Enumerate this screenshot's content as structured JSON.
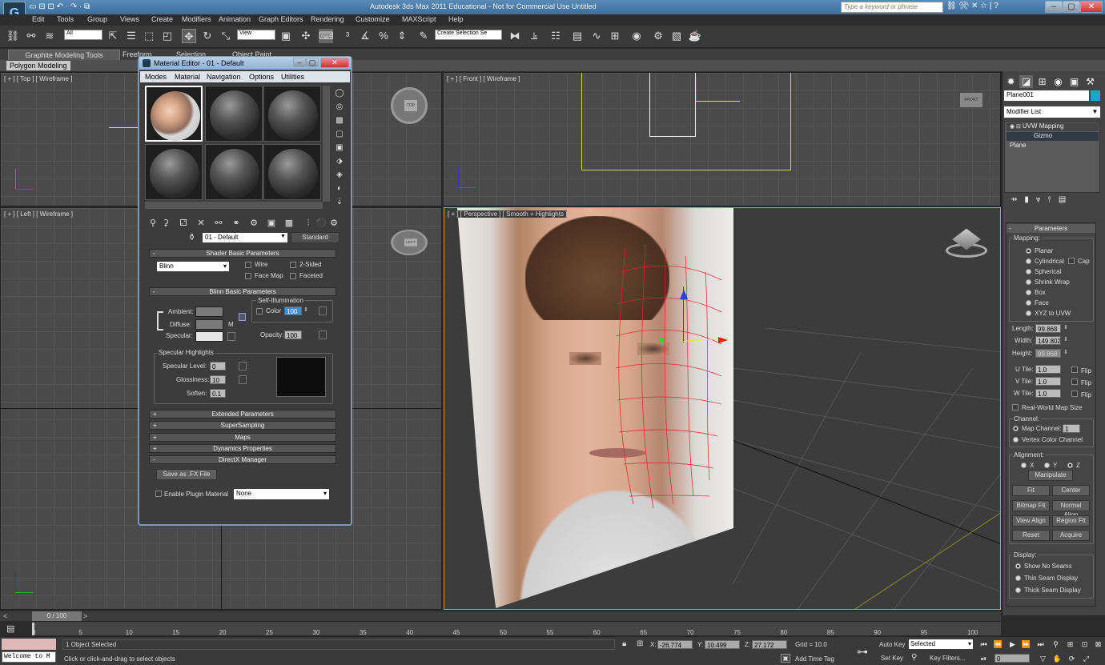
{
  "app": {
    "title": "Autodesk 3ds Max 2011   Educational - Not for Commercial Use   Untitled",
    "search_placeholder": "Type a keyword or phrase",
    "logo_letter": "G"
  },
  "menubar": [
    "Edit",
    "Tools",
    "Group",
    "Views",
    "Create",
    "Modifiers",
    "Animation",
    "Graph Editors",
    "Rendering",
    "Customize",
    "MAXScript",
    "Help"
  ],
  "toolbar": {
    "selection_filter": "All",
    "ref_coord": "View",
    "named_selection": "Create Selection Se"
  },
  "ribbon": {
    "tabs": [
      "Graphite Modeling Tools",
      "Freeform",
      "Selection",
      "Object Paint"
    ],
    "subtab": "Polygon Modeling"
  },
  "viewports": {
    "top": {
      "label": "[ + ] [ Top ] [ Wireframe ]",
      "cube": "TOP"
    },
    "front": {
      "label": "[ + ] [ Front ] [ Wireframe ]",
      "cube": "FRONT"
    },
    "left": {
      "label": "[ + ] [ Left ] [ Wireframe ]",
      "cube": "LEFT"
    },
    "persp": {
      "label": "[ + ] [ Perspective ] [ Smooth + Highlights ]"
    }
  },
  "command_panel": {
    "object_name": "Plane001",
    "object_color": "#1ca6cc",
    "modifier_list": "Modifier List",
    "stack": [
      "UVW Mapping",
      "Gizmo",
      "Plane"
    ],
    "parameters": {
      "title": "Parameters",
      "mapping_label": "Mapping:",
      "mapping_options": [
        "Planar",
        "Cylindrical",
        "Spherical",
        "Shrink Wrap",
        "Box",
        "Face",
        "XYZ to UVW"
      ],
      "cap_label": "Cap",
      "length_label": "Length:",
      "length": "99.868",
      "width_label": "Width:",
      "width": "149.802",
      "height_label": "Height:",
      "height": "99.868",
      "utile_label": "U Tile:",
      "utile": "1.0",
      "vtile_label": "V Tile:",
      "vtile": "1.0",
      "wtile_label": "W Tile:",
      "wtile": "1.0",
      "flip_label": "Flip",
      "realworld": "Real-World Map Size",
      "channel_label": "Channel:",
      "map_channel_label": "Map Channel:",
      "map_channel": "1",
      "vertex_color_channel": "Vertex Color Channel",
      "alignment_label": "Alignment:",
      "axes": [
        "X",
        "Y",
        "Z"
      ],
      "buttons": [
        "Manipulate",
        "Fit",
        "Center",
        "Bitmap Fit",
        "Normal Align",
        "View Align",
        "Region Fit",
        "Reset",
        "Acquire"
      ],
      "display_label": "Display:",
      "display_options": [
        "Show No Seams",
        "Thin Seam Display",
        "Thick Seam Display"
      ]
    }
  },
  "material_editor": {
    "title": "Material Editor - 01 - Default",
    "menu": [
      "Modes",
      "Material",
      "Navigation",
      "Options",
      "Utilities"
    ],
    "material_name": "01 - Default",
    "material_type": "Standard",
    "shader_rollout": "Shader Basic Parameters",
    "shader": "Blinn",
    "wire": "Wire",
    "two_sided": "2-Sided",
    "face_map": "Face Map",
    "faceted": "Faceted",
    "blinn_rollout": "Blinn Basic Parameters",
    "self_illum": "Self-Illumination",
    "color_label": "Color",
    "color_value": "100",
    "ambient": "Ambient:",
    "diffuse": "Diffuse:",
    "specular": "Specular:",
    "m_label": "M",
    "opacity_label": "Opacity:",
    "opacity": "100",
    "spec_highlights": "Specular Highlights",
    "spec_level_label": "Specular Level:",
    "spec_level": "0",
    "glossiness_label": "Glossiness:",
    "glossiness": "10",
    "soften_label": "Soften:",
    "soften": "0.1",
    "rollouts": [
      "Extended Parameters",
      "SuperSampling",
      "Maps",
      "Dynamics Properties",
      "DirectX Manager"
    ],
    "save_fx": "Save as .FX File",
    "enable_plugin": "Enable Plugin Material",
    "plugin_value": "None"
  },
  "timeline": {
    "frame": "0 / 100",
    "ticks": [
      "0",
      "5",
      "10",
      "15",
      "20",
      "25",
      "30",
      "35",
      "40",
      "45",
      "50",
      "55",
      "60",
      "65",
      "70",
      "75",
      "80",
      "85",
      "90",
      "95",
      "100"
    ]
  },
  "status": {
    "maxscript": "Welcome to M",
    "selected": "1 Object Selected",
    "prompt": "Click or click-and-drag to select objects",
    "x_label": "X:",
    "x": "-26.774",
    "y_label": "Y:",
    "y": "10.499",
    "z_label": "Z:",
    "z": "27.172",
    "grid": "Grid = 10.0",
    "add_time_tag": "Add Time Tag",
    "auto_key": "Auto Key",
    "set_key": "Set Key",
    "key_mode": "Selected",
    "key_filters": "Key Filters...",
    "current_frame": "0"
  }
}
